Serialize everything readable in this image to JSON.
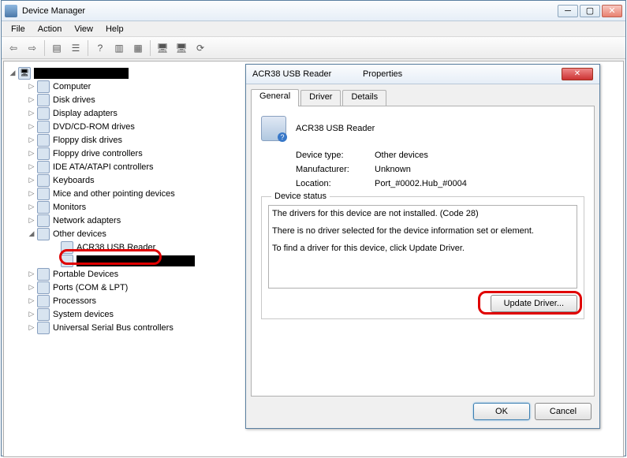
{
  "window": {
    "title": "Device Manager",
    "menus": [
      "File",
      "Action",
      "View",
      "Help"
    ]
  },
  "tree": {
    "root_label": "",
    "nodes": [
      {
        "label": "Computer"
      },
      {
        "label": "Disk drives"
      },
      {
        "label": "Display adapters"
      },
      {
        "label": "DVD/CD-ROM drives"
      },
      {
        "label": "Floppy disk drives"
      },
      {
        "label": "Floppy drive controllers"
      },
      {
        "label": "IDE ATA/ATAPI controllers"
      },
      {
        "label": "Keyboards"
      },
      {
        "label": "Mice and other pointing devices"
      },
      {
        "label": "Monitors"
      },
      {
        "label": "Network adapters"
      },
      {
        "label": "Other devices",
        "expanded": true
      },
      {
        "label": "ACR38 USB Reader",
        "child": true,
        "highlight": true
      },
      {
        "label": "",
        "child": true,
        "redact": true
      },
      {
        "label": "Portable Devices"
      },
      {
        "label": "Ports (COM & LPT)"
      },
      {
        "label": "Processors"
      },
      {
        "label": "System devices"
      },
      {
        "label": "Universal Serial Bus controllers"
      }
    ]
  },
  "dialog": {
    "title_left": "ACR38 USB Reader",
    "title_right": "Properties",
    "tabs": [
      "General",
      "Driver",
      "Details"
    ],
    "active_tab": 0,
    "device_name": "ACR38 USB Reader",
    "info": [
      {
        "k": "Device type:",
        "v": "Other devices"
      },
      {
        "k": "Manufacturer:",
        "v": "Unknown"
      },
      {
        "k": "Location:",
        "v": "Port_#0002.Hub_#0004"
      }
    ],
    "status_legend": "Device status",
    "status_lines": [
      "The drivers for this device are not installed. (Code 28)",
      "There is no driver selected for the device information set or element.",
      "To find a driver for this device, click Update Driver."
    ],
    "update_button": "Update Driver...",
    "ok": "OK",
    "cancel": "Cancel"
  }
}
